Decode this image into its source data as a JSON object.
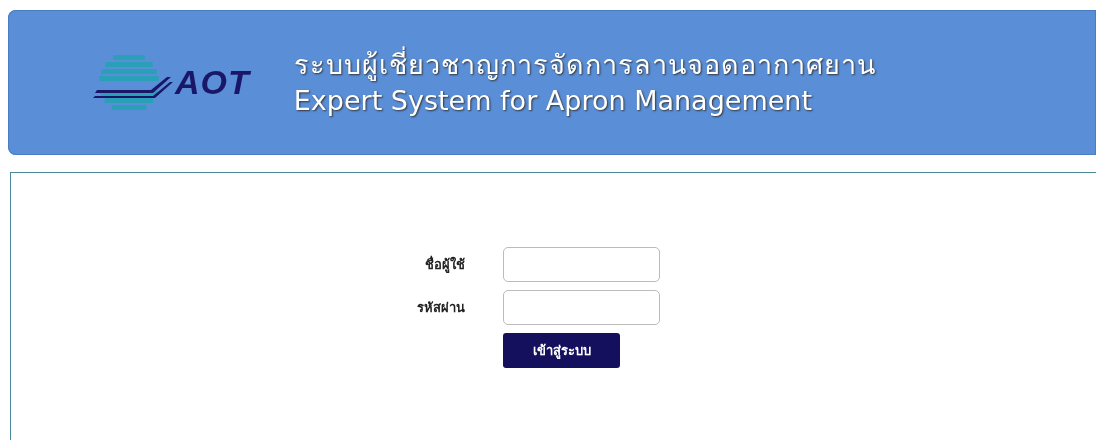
{
  "header": {
    "logo_text": "AOT",
    "title_thai": "ระบบผู้เชี่ยวชาญการจัดการลานจอดอากาศยาน",
    "title_english": "Expert System for Apron Management"
  },
  "login_form": {
    "fields": [
      {
        "label": "ชื่อผู้ใช้"
      },
      {
        "label": "รหัสผ่าน"
      }
    ],
    "submit_button": "เข้าสู่ระบบ"
  }
}
